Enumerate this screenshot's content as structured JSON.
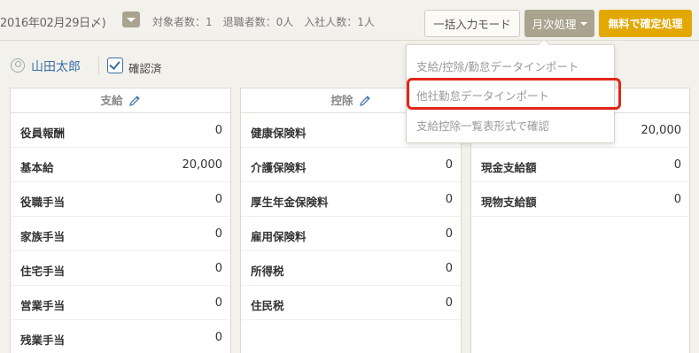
{
  "header": {
    "date": "2016年02月29日〆)",
    "stats": "対象者数：1　退職者数：0人　入社人数：1人",
    "bulk_input_label": "一括入力モード",
    "monthly_process_label": "月次処理",
    "free_confirm_label": "無料で確定処理"
  },
  "user": {
    "name": "山田太郎",
    "confirmed_label": "確認済"
  },
  "panels": {
    "payment": {
      "title": "支給",
      "rows": [
        {
          "label": "役員報酬",
          "value": "0"
        },
        {
          "label": "基本給",
          "value": "20,000"
        },
        {
          "label": "役職手当",
          "value": "0"
        },
        {
          "label": "家族手当",
          "value": "0"
        },
        {
          "label": "住宅手当",
          "value": "0"
        },
        {
          "label": "営業手当",
          "value": "0"
        },
        {
          "label": "残業手当",
          "value": "0"
        }
      ]
    },
    "deduction": {
      "title": "控除",
      "rows": [
        {
          "label": "健康保険料",
          "value": "0"
        },
        {
          "label": "介護保険料",
          "value": "0"
        },
        {
          "label": "厚生年金保険料",
          "value": "0"
        },
        {
          "label": "雇用保険料",
          "value": "0"
        },
        {
          "label": "所得税",
          "value": "0"
        },
        {
          "label": "住民税",
          "value": "0"
        }
      ]
    },
    "total": {
      "rows": [
        {
          "label": "",
          "value": "20,000"
        },
        {
          "label": "現金支給額",
          "value": "0"
        },
        {
          "label": "現物支給額",
          "value": "0"
        }
      ]
    }
  },
  "menu": {
    "items": [
      "支給/控除/勤怠データインポート",
      "他社勤怠データインポート",
      "支給控除一覧表形式で確認"
    ]
  },
  "colors": {
    "accent_gold": "#e2a800",
    "monthly_button": "#a9a38f",
    "highlight_red": "#e0261a",
    "link_blue": "#3c6fa8"
  }
}
